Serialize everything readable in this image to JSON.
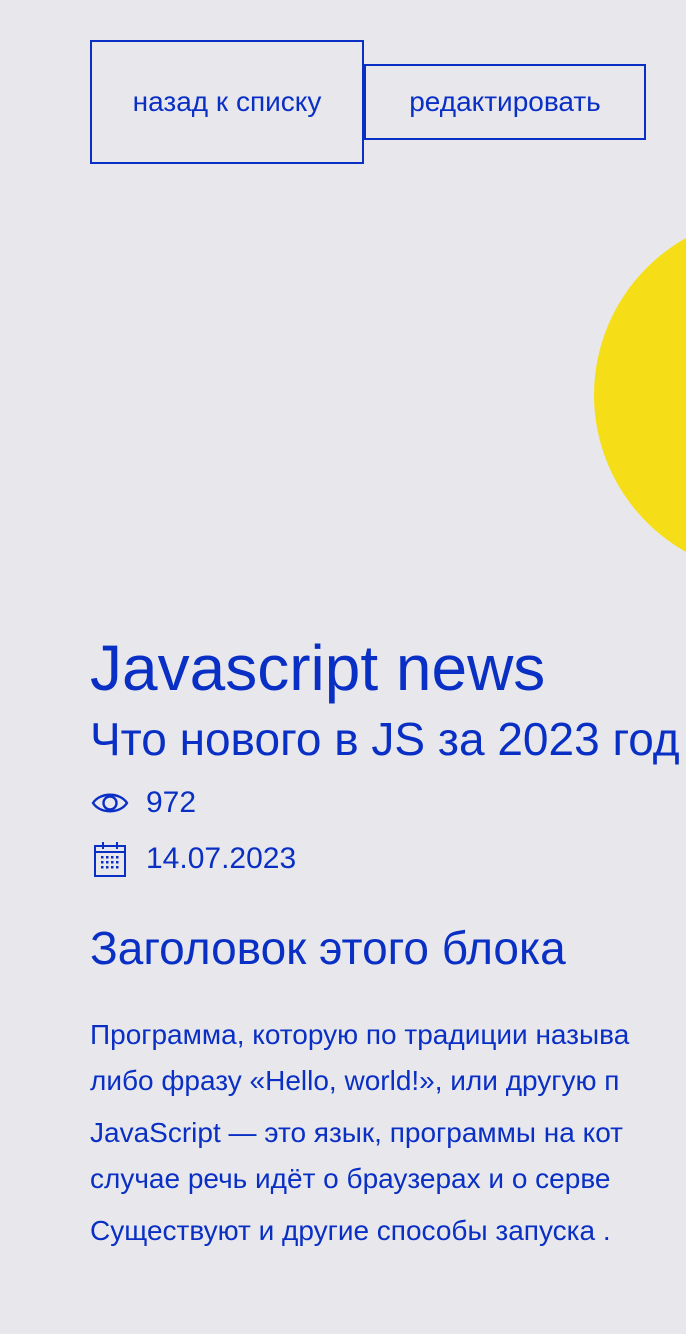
{
  "toolbar": {
    "back_label": "назад к списку",
    "edit_label": "редактировать"
  },
  "article": {
    "title": "Javascript news",
    "subtitle": "Что нового в JS за 2023 год",
    "views": "972",
    "date": "14.07.2023",
    "block_heading": "Заголовок этого блока",
    "paragraphs": [
      {
        "line1": "Программа, которую по традиции называ",
        "line2": "либо фразу «Hello, world!», или другую п"
      },
      {
        "line1": "JavaScript — это язык, программы на кот",
        "line2": "случае речь идёт о браузерах и о серве"
      },
      {
        "line1": "Существуют и другие способы запуска ."
      }
    ]
  },
  "icons": {
    "views": "eye-icon",
    "date": "calendar-icon"
  },
  "colors": {
    "accent": "#0a2fc4",
    "background": "#e8e8ec",
    "decor_circle": "#f5de18"
  }
}
